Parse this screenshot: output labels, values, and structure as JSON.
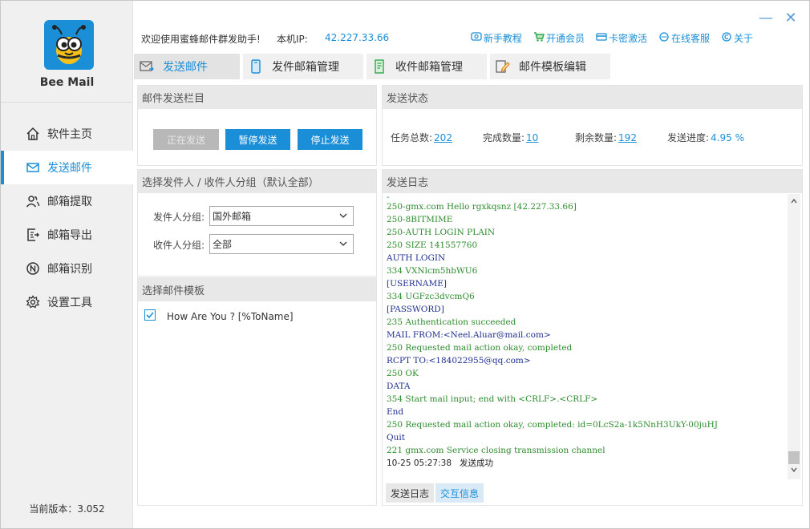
{
  "app": {
    "name": "Bee Mail",
    "version_label": "当前版本：3.052"
  },
  "sidebar": {
    "items": [
      {
        "label": "软件主页",
        "icon": "home-icon"
      },
      {
        "label": "发送邮件",
        "icon": "mail-icon",
        "active": true
      },
      {
        "label": "邮箱提取",
        "icon": "users-icon"
      },
      {
        "label": "邮箱导出",
        "icon": "export-icon"
      },
      {
        "label": "邮箱识别",
        "icon": "identify-icon"
      },
      {
        "label": "设置工具",
        "icon": "gear-icon"
      }
    ]
  },
  "header": {
    "welcome": "欢迎使用蜜蜂邮件群发助手!",
    "ip_label": "本机IP:",
    "ip_value": "42.227.33.66",
    "links": [
      {
        "label": "新手教程",
        "icon": "tutorial-icon"
      },
      {
        "label": "开通会员",
        "icon": "cart-icon"
      },
      {
        "label": "卡密激活",
        "icon": "card-icon"
      },
      {
        "label": "在线客服",
        "icon": "chat-icon"
      },
      {
        "label": "关于",
        "icon": "copyright-icon"
      }
    ],
    "window_controls": {
      "minimize": "—",
      "close": "✕"
    }
  },
  "tabs": [
    {
      "label": "发送邮件",
      "icon": "mail-send-icon",
      "active": true
    },
    {
      "label": "发件邮箱管理",
      "icon": "phone-icon"
    },
    {
      "label": "收件邮箱管理",
      "icon": "document-icon"
    },
    {
      "label": "邮件模板编辑",
      "icon": "edit-icon"
    }
  ],
  "send_panel": {
    "title": "邮件发送栏目",
    "buttons": {
      "sending": "正在发送",
      "pause": "暂停发送",
      "stop": "停止发送"
    }
  },
  "group_panel": {
    "title": "选择发件人 / 收件人分组（默认全部）",
    "sender_label": "发件人分组:",
    "sender_value": "国外邮箱",
    "receiver_label": "收件人分组:",
    "receiver_value": "全部"
  },
  "template_panel": {
    "title": "选择邮件模板",
    "item_label": "How Are You ? [%ToName]",
    "item_checked": true
  },
  "status_panel": {
    "title": "发送状态",
    "total_label": "任务总数:",
    "total_value": "202",
    "done_label": "完成数量:",
    "done_value": "10",
    "remain_label": "剩余数量:",
    "remain_value": "192",
    "progress_label": "发送进度:",
    "progress_value": "4.95 %"
  },
  "log_panel": {
    "title": "发送日志",
    "colors": {
      "green": "#2e8b2e",
      "navy": "#1f2f8f",
      "black": "#222222"
    },
    "lines": [
      {
        "text": "250-gmx.com Hello rgxkqsnz [42.227.33.66]",
        "color": "green"
      },
      {
        "text": "250-8BITMIME",
        "color": "green"
      },
      {
        "text": "250-AUTH LOGIN PLAIN",
        "color": "green"
      },
      {
        "text": "250 SIZE 141557760",
        "color": "green"
      },
      {
        "text": "AUTH LOGIN",
        "color": "navy"
      },
      {
        "text": "334 VXNlcm5hbWU6",
        "color": "green"
      },
      {
        "text": "[USERNAME]",
        "color": "navy"
      },
      {
        "text": "334 UGFzc3dvcmQ6",
        "color": "green"
      },
      {
        "text": "[PASSWORD]",
        "color": "navy"
      },
      {
        "text": "235 Authentication succeeded",
        "color": "green"
      },
      {
        "text": "MAIL FROM:<Neel.Aluar@mail.com>",
        "color": "navy"
      },
      {
        "text": "250 Requested mail action okay, completed",
        "color": "green"
      },
      {
        "text": "RCPT TO:<184022955@qq.com>",
        "color": "navy"
      },
      {
        "text": "250 OK",
        "color": "green"
      },
      {
        "text": "DATA",
        "color": "navy"
      },
      {
        "text": "354 Start mail input; end with <CRLF>.<CRLF>",
        "color": "green"
      },
      {
        "text": "End",
        "color": "navy"
      },
      {
        "text": "250 Requested mail action okay, completed: id=0LcS2a-1k5NnH3UkY-00juHJ",
        "color": "green"
      },
      {
        "text": "Quit",
        "color": "navy"
      },
      {
        "text": "221 gmx.com Service closing transmission channel",
        "color": "green"
      }
    ],
    "last_time": "10-25 05:27:38",
    "last_status": "发送成功",
    "tabs": [
      "发送日志",
      "交互信息"
    ]
  }
}
